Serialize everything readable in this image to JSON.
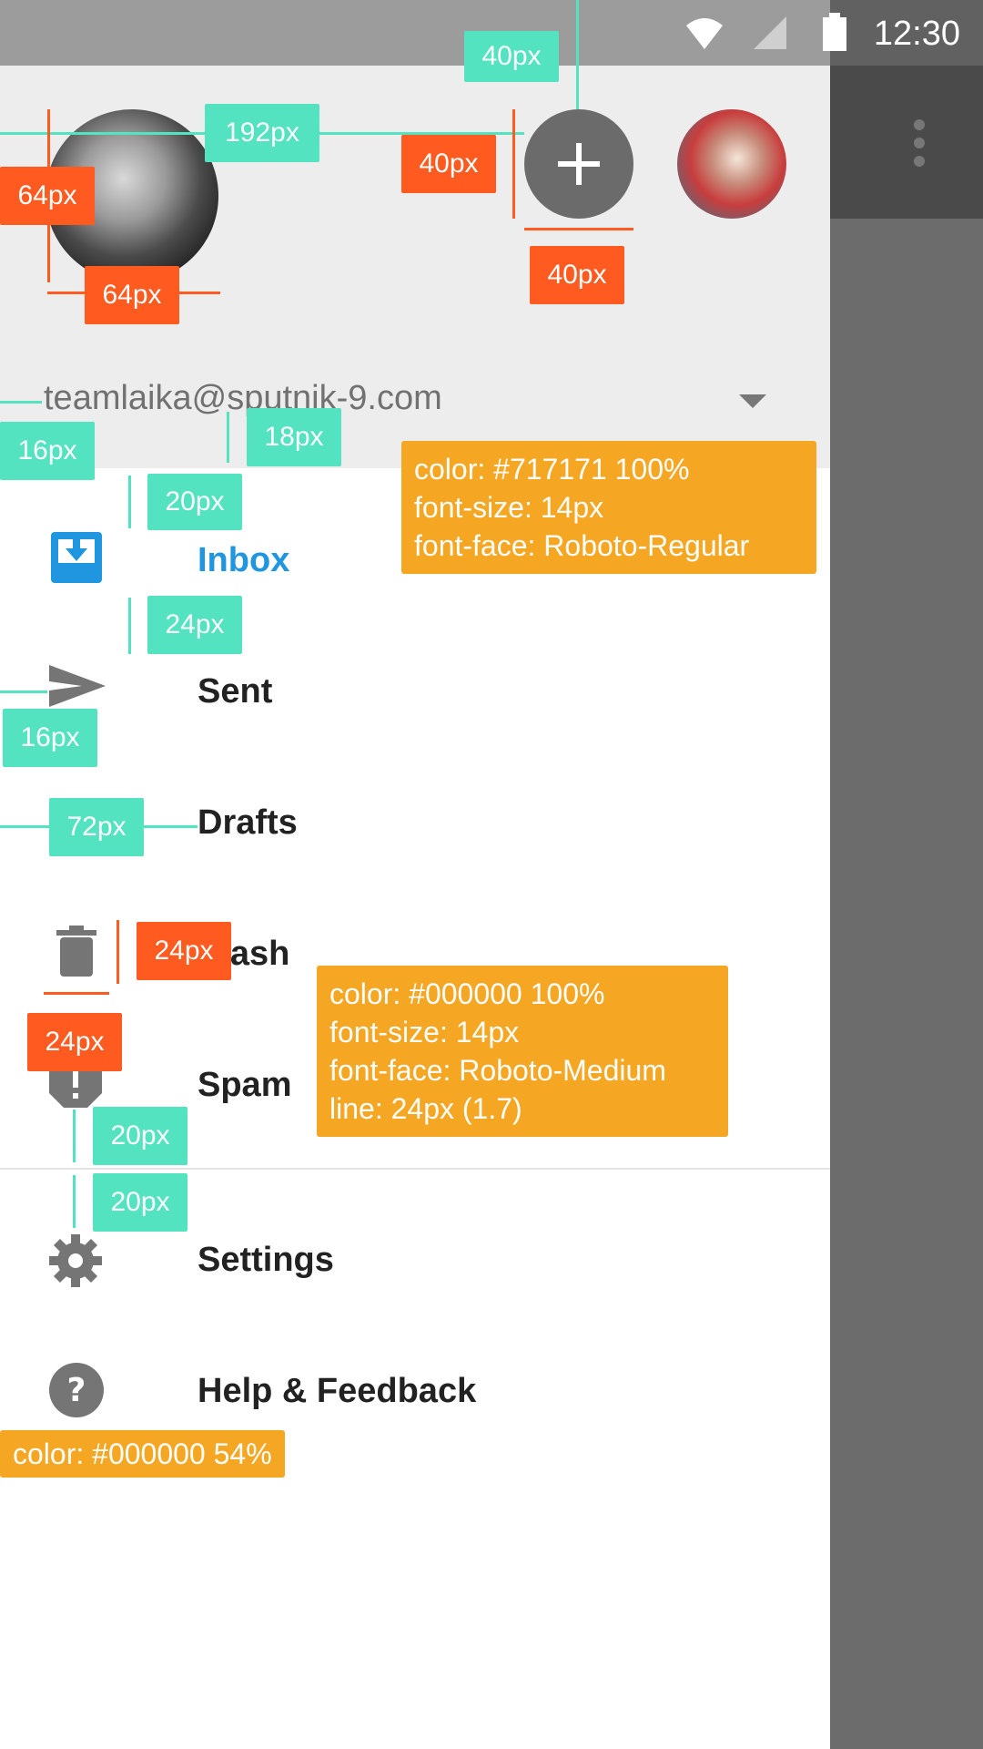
{
  "status_bar": {
    "time": "12:30"
  },
  "account": {
    "email": "teamlaika@sputnik-9.com"
  },
  "nav": {
    "items": [
      {
        "label": "Inbox",
        "icon": "inbox-icon",
        "active": true
      },
      {
        "label": "Sent",
        "icon": "send-icon"
      },
      {
        "label": "Drafts",
        "icon": "drafts-icon"
      },
      {
        "label": "Trash",
        "icon": "trash-icon"
      },
      {
        "label": "Spam",
        "icon": "spam-icon"
      }
    ],
    "secondary": [
      {
        "label": "Settings",
        "icon": "settings-icon"
      },
      {
        "label": "Help & Feedback",
        "icon": "help-icon"
      }
    ]
  },
  "annotations": {
    "dims": {
      "top40": "40px",
      "w192": "192px",
      "h64": "64px",
      "w64": "64px",
      "h40": "40px",
      "w40": "40px",
      "l16": "16px",
      "b18": "18px",
      "t20": "20px",
      "g24": "24px",
      "i16": "16px",
      "k72": "72px",
      "h24": "24px",
      "w24": "24px",
      "s20a": "20px",
      "s20b": "20px"
    },
    "note_email": [
      "color: #717171 100%",
      "font-size: 14px",
      "font-face: Roboto-Regular"
    ],
    "note_nav": [
      "color: #000000 100%",
      "font-size: 14px",
      "font-face: Roboto-Medium",
      "line: 24px (1.7)"
    ],
    "note_icon": "color: #000000 54%"
  },
  "colors": {
    "accent": "#2196e0",
    "email_text": "#717171",
    "nav_text": "#000000",
    "icon": "#000000 54%"
  }
}
